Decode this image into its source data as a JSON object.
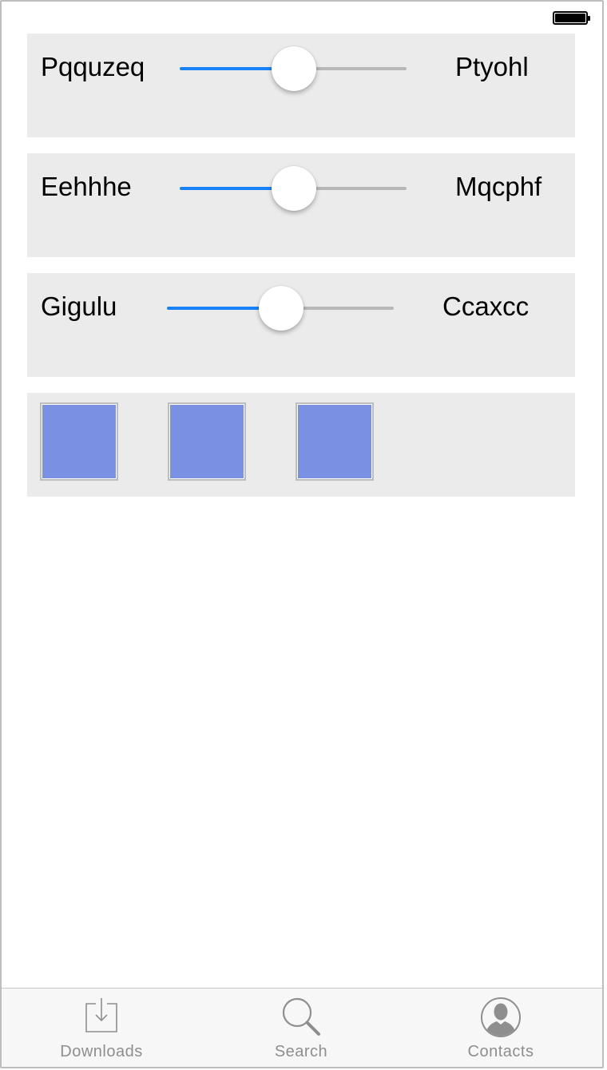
{
  "sliders": [
    {
      "left_label": "Pqquzeq",
      "right_label": "Ptyohl",
      "value": 0.5
    },
    {
      "left_label": "Eehhhe",
      "right_label": "Mqcphf",
      "value": 0.5
    },
    {
      "left_label": "Gigulu",
      "right_label": "Ccaxcc",
      "value": 0.5
    }
  ],
  "swatches": {
    "color": "#7990e3",
    "count": 3
  },
  "tabs": [
    {
      "label": "Downloads",
      "icon": "download-icon"
    },
    {
      "label": "Search",
      "icon": "search-icon"
    },
    {
      "label": "Contacts",
      "icon": "contact-icon"
    }
  ],
  "colors": {
    "accent": "#1a82f7",
    "panel": "#ebebeb",
    "tab_bar": "#f7f7f7"
  }
}
